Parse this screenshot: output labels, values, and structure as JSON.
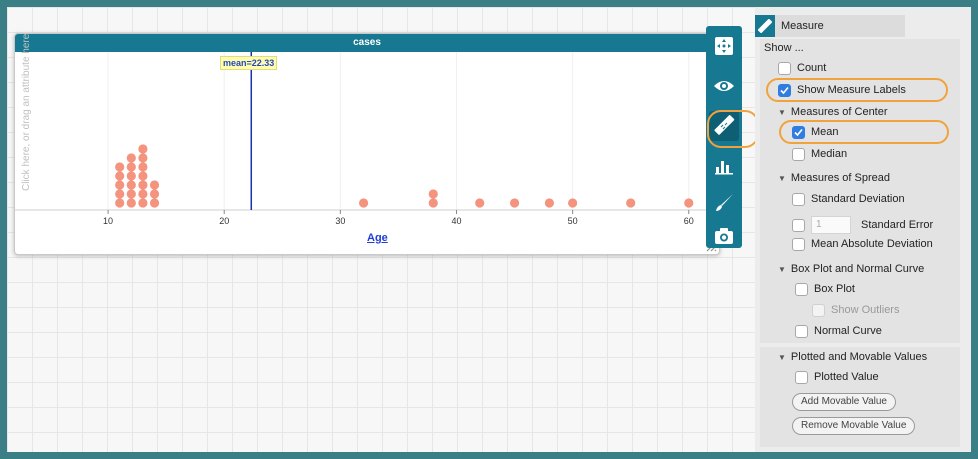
{
  "graph": {
    "title": "cases",
    "y_drop_hint": "Click here, or drag an attribute here",
    "x_axis_label": "Age",
    "mean_label": "mean=22.33",
    "point_color": "#f4937e",
    "mean_line_color": "#1d2fb3"
  },
  "chart_data": {
    "type": "dot",
    "x_attribute": "Age",
    "xlim": [
      5,
      62
    ],
    "x_ticks": [
      10,
      20,
      30,
      40,
      50,
      60
    ],
    "points": [
      {
        "x": 11,
        "count": 5
      },
      {
        "x": 12,
        "count": 6
      },
      {
        "x": 13,
        "count": 7
      },
      {
        "x": 14,
        "count": 3
      },
      {
        "x": 32,
        "count": 1
      },
      {
        "x": 38,
        "count": 2
      },
      {
        "x": 42,
        "count": 1
      },
      {
        "x": 45,
        "count": 1
      },
      {
        "x": 48,
        "count": 1
      },
      {
        "x": 50,
        "count": 1
      },
      {
        "x": 55,
        "count": 1
      },
      {
        "x": 60,
        "count": 1
      }
    ],
    "mean": 22.33
  },
  "toolbar": {
    "tools": [
      "move-icon",
      "eye-icon",
      "ruler-icon",
      "bar-chart-icon",
      "brush-icon",
      "camera-icon"
    ],
    "active": "ruler-icon"
  },
  "measure_panel": {
    "title": "Measure",
    "show_label": "Show ...",
    "count_label": "Count",
    "show_measure_labels": "Show Measure Labels",
    "center_header": "Measures of Center",
    "mean_label": "Mean",
    "median_label": "Median",
    "spread_header": "Measures of Spread",
    "std_dev_label": "Standard Deviation",
    "std_err_value": "1",
    "std_err_label": "Standard Error",
    "mad_label": "Mean Absolute Deviation",
    "box_header": "Box Plot and Normal Curve",
    "box_plot_label": "Box Plot",
    "show_outliers_label": "Show Outliers",
    "normal_curve_label": "Normal Curve",
    "plotted_header": "Plotted and Movable Values",
    "plotted_value_label": "Plotted Value",
    "add_movable_button": "Add Movable Value",
    "remove_movable_button": "Remove Movable Value",
    "highlight_color": "#f2a23c"
  }
}
